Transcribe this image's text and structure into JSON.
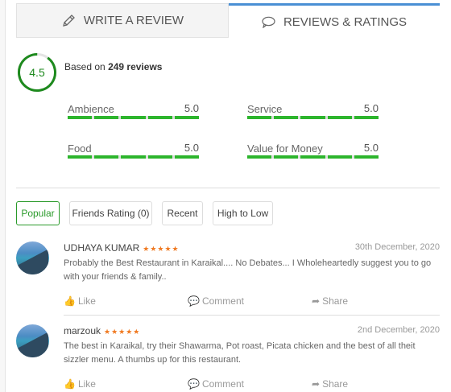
{
  "tabs": [
    {
      "label": "WRITE A REVIEW",
      "icon": "pencil-icon"
    },
    {
      "label": "REVIEWS & RATINGS",
      "icon": "speech-bubble-icon",
      "active": true
    }
  ],
  "summary": {
    "score": "4.5",
    "score_fraction": 0.9,
    "based_prefix": "Based on",
    "based_count": "249 reviews"
  },
  "ratings": [
    {
      "label": "Ambience",
      "value": "5.0"
    },
    {
      "label": "Service",
      "value": "5.0"
    },
    {
      "label": "Food",
      "value": "5.0"
    },
    {
      "label": "Value for Money",
      "value": "5.0"
    }
  ],
  "filters": [
    {
      "label": "Popular",
      "active": true
    },
    {
      "label": "Friends Rating (0)"
    },
    {
      "label": "Recent"
    },
    {
      "label": "High to Low"
    }
  ],
  "reviews": [
    {
      "name": "UDHAYA KUMAR",
      "stars": "★★★★★",
      "date": "30th December, 2020",
      "text": "Probably the Best Restaurant in Karaikal.... No Debates... I Wholeheartedly suggest you to go with your friends & family.."
    },
    {
      "name": "marzouk",
      "stars": "★★★★★",
      "date": "2nd December, 2020",
      "text": "The best in Karaikal, try their Shawarma, Pot roast, Picata chicken and the best of all theit sizzler menu. A thumbs up for this restaurant."
    }
  ],
  "actions": {
    "like": "Like",
    "comment": "Comment",
    "share": "Share"
  },
  "colors": {
    "accent_green": "#2db52d",
    "tab_active": "#4a8fd4",
    "stars": "#f07a22"
  }
}
